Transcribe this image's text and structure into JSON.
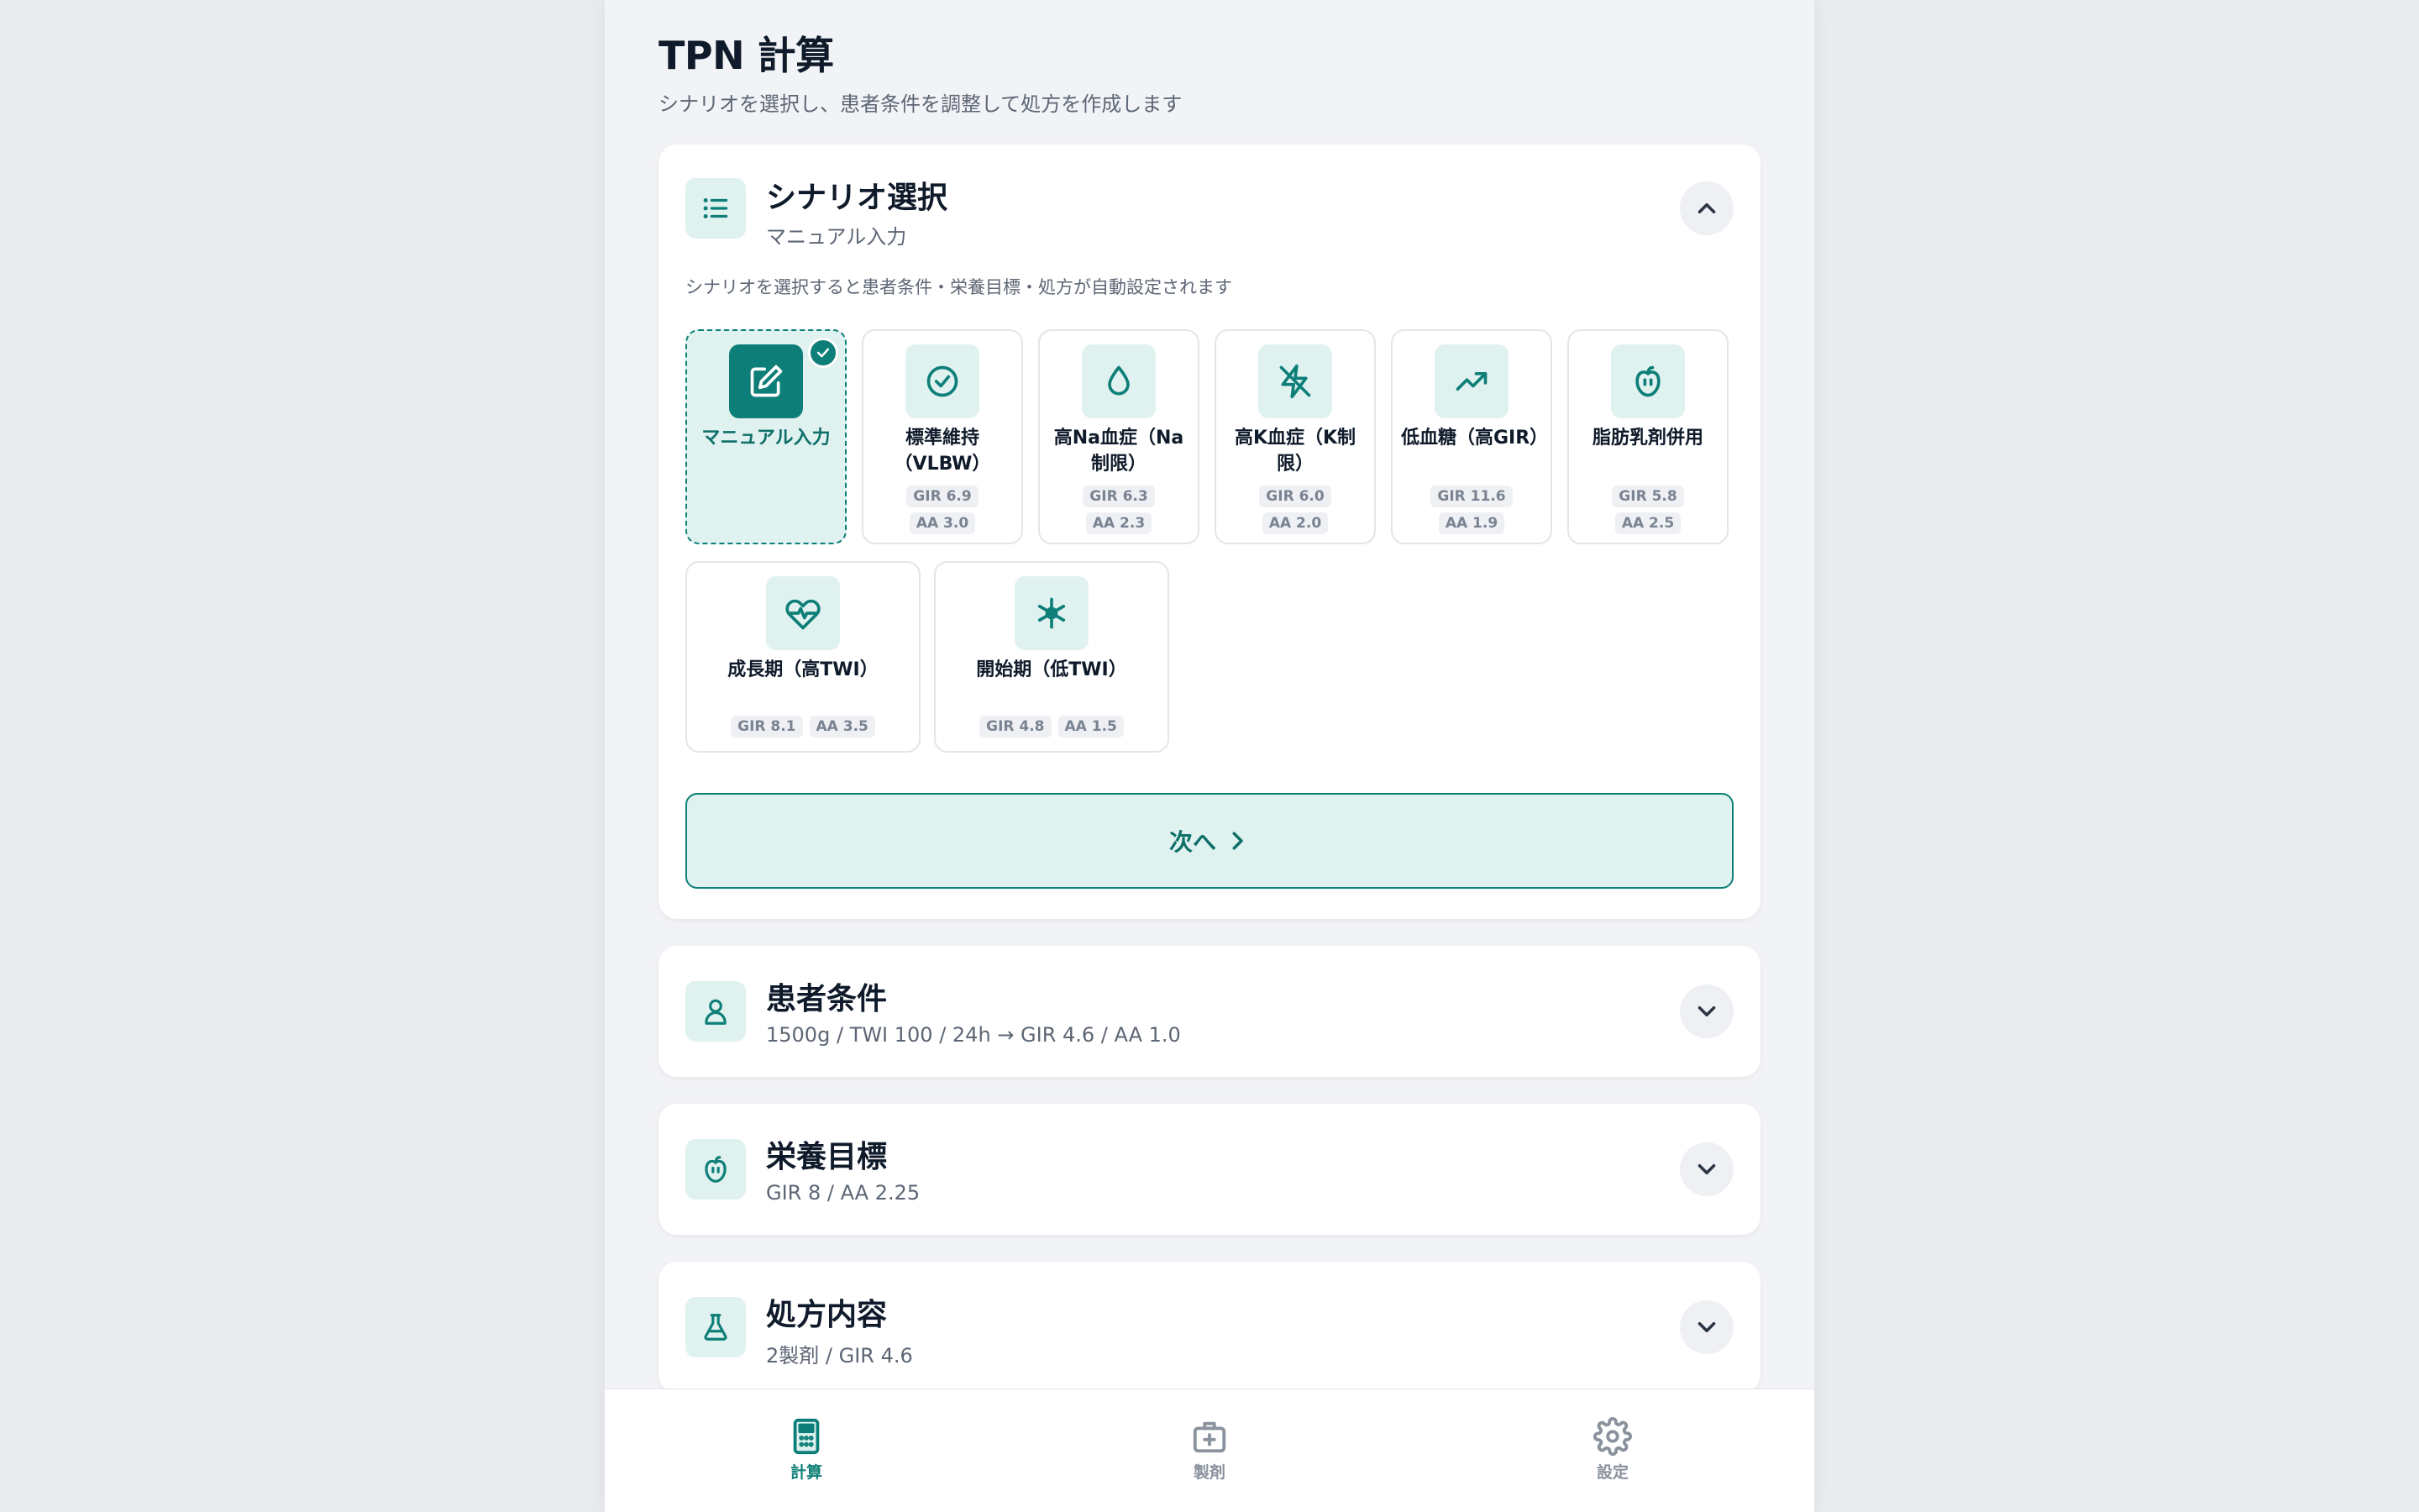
{
  "header": {
    "title": "TPN 計算",
    "subtitle": "シナリオを選択し、患者条件を調整して処方を作成します"
  },
  "scenario_card": {
    "title": "シナリオ選択",
    "subtitle": "マニュアル入力",
    "hint": "シナリオを選択すると患者条件・栄養目標・処方が自動設定されます",
    "icon": "list-icon",
    "expanded": true,
    "scenarios": [
      {
        "label": "マニュアル入力",
        "gir": "",
        "aa": "",
        "icon": "edit-icon",
        "selected": true
      },
      {
        "label": "標準維持（VLBW）",
        "gir": "GIR 6.9",
        "aa": "AA 3.0",
        "icon": "check-circle-icon",
        "selected": false
      },
      {
        "label": "高Na血症（Na制限）",
        "gir": "GIR 6.3",
        "aa": "AA 2.3",
        "icon": "droplet-icon",
        "selected": false
      },
      {
        "label": "高K血症（K制限）",
        "gir": "GIR 6.0",
        "aa": "AA 2.0",
        "icon": "zap-off-icon",
        "selected": false
      },
      {
        "label": "低血糖（高GIR）",
        "gir": "GIR 11.6",
        "aa": "AA 1.9",
        "icon": "trending-up-icon",
        "selected": false
      },
      {
        "label": "脂肪乳剤併用",
        "gir": "GIR 5.8",
        "aa": "AA 2.5",
        "icon": "apple-icon",
        "selected": false
      },
      {
        "label": "成長期（高TWI）",
        "gir": "GIR 8.1",
        "aa": "AA 3.5",
        "icon": "heart-pulse-icon",
        "selected": false
      },
      {
        "label": "開始期（低TWI）",
        "gir": "GIR 4.8",
        "aa": "AA 1.5",
        "icon": "asterisk-icon",
        "selected": false
      }
    ],
    "next_label": "次へ"
  },
  "patient_card": {
    "title": "患者条件",
    "summary": "1500g / TWI 100 / 24h → GIR 4.6 / AA 1.0",
    "icon": "user-icon"
  },
  "nutrition_card": {
    "title": "栄養目標",
    "summary": "GIR 8 / AA 2.25",
    "icon": "apple-icon"
  },
  "prescription_card": {
    "title": "処方内容",
    "summary": "2製剤 / GIR 4.6",
    "icon": "flask-icon"
  },
  "tabbar": {
    "tabs": [
      {
        "label": "計算",
        "icon": "calculator-icon",
        "active": true
      },
      {
        "label": "製剤",
        "icon": "medical-kit-icon",
        "active": false
      },
      {
        "label": "設定",
        "icon": "gear-icon",
        "active": false
      }
    ]
  },
  "colors": {
    "accent": "#0e7f78",
    "accent_light": "#e0f2f0",
    "background": "#f2f3f6",
    "text": "#0f1a2a",
    "muted": "#5d6675"
  }
}
